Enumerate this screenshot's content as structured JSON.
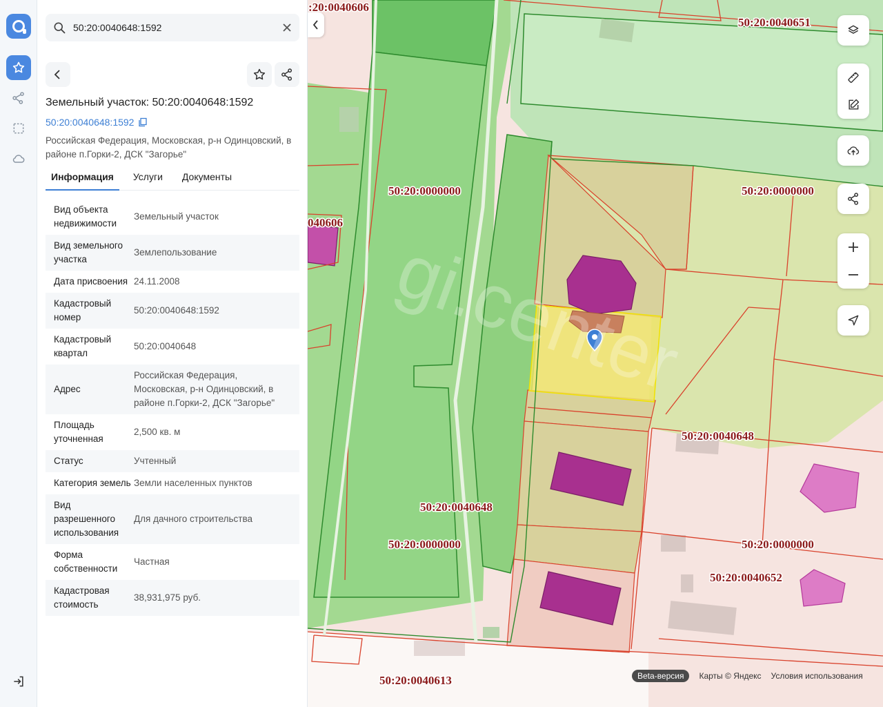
{
  "search": {
    "value": "50:20:0040648:1592"
  },
  "object": {
    "title": "Земельный участок: 50:20:0040648:1592",
    "cad_link": "50:20:0040648:1592",
    "address": "Российская Федерация, Московская, р-н Одинцовский, в районе п.Горки-2, ДСК \"Загорье\""
  },
  "tabs": [
    {
      "label": "Информация"
    },
    {
      "label": "Услуги"
    },
    {
      "label": "Документы"
    }
  ],
  "info_rows": [
    {
      "key": "Вид объекта недвижимости",
      "value": "Земельный участок"
    },
    {
      "key": "Вид земельного участка",
      "value": "Землепользование"
    },
    {
      "key": "Дата присвоения",
      "value": "24.11.2008"
    },
    {
      "key": "Кадастровый номер",
      "value": "50:20:0040648:1592"
    },
    {
      "key": "Кадастровый квартал",
      "value": "50:20:0040648"
    },
    {
      "key": "Адрес",
      "value": "Российская Федерация, Московская, р-н Одинцовский, в районе п.Горки-2, ДСК \"Загорье\""
    },
    {
      "key": "Площадь уточненная",
      "value": "2,500 кв. м"
    },
    {
      "key": "Статус",
      "value": "Учтенный"
    },
    {
      "key": "Категория земель",
      "value": "Земли населенных пунктов"
    },
    {
      "key": "Вид разрешенного использования",
      "value": "Для дачного строительства"
    },
    {
      "key": "Форма собственности",
      "value": "Частная"
    },
    {
      "key": "Кадастровая стоимость",
      "value": "38,931,975 руб."
    }
  ],
  "map_labels": {
    "l1": ":20:0040606",
    "l2": "50:20:0040651",
    "l3": "50:20:0000000",
    "l4": "50:20:0000000",
    "l5": "040606",
    "l6": "50:20:0040648",
    "l7": "50:20:0040648",
    "l8": "50:20:0000000",
    "l9": "50:20:0000000",
    "l10": "50:20:0040652",
    "l11": "50:20:0040613",
    "watermark": "gi.center"
  },
  "attribution": {
    "beta": "Beta-версия",
    "maps": "Карты © Яндекс",
    "terms": "Условия использования"
  },
  "colors": {
    "accent": "#4a88e0",
    "parcel_border": "#d9412b",
    "label_color": "#8b1a1a",
    "selected_fill": "#f2ee6a",
    "building": "#a8308f"
  }
}
